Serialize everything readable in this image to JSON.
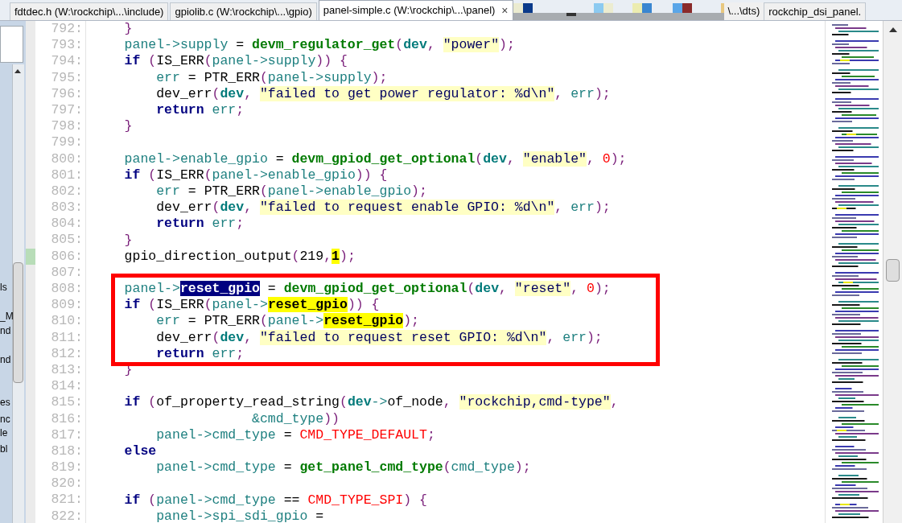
{
  "tabs": [
    {
      "label": "fdtdec.h (W:\\rockchip\\...\\include)",
      "selected": false
    },
    {
      "label": "gpiolib.c (W:\\rockchip\\...\\gpio)",
      "selected": false
    },
    {
      "label": "panel-simple.c (W:\\rockchip\\...\\panel)",
      "selected": true,
      "close": "×"
    },
    {
      "label": "\\...\\dts)",
      "selected": false,
      "kind": "covered"
    },
    {
      "label": "rockchip_dsi_panel.",
      "selected": false
    }
  ],
  "side_panel": {
    "fragments": [
      "ls",
      "_M",
      "nd",
      "nd",
      "es",
      "nc",
      "le",
      "bl"
    ]
  },
  "editor": {
    "lines": [
      {
        "number": "792:",
        "tokens": [
          {
            "text": "    }",
            "kind": "punct"
          }
        ]
      },
      {
        "number": "793:",
        "tokens": [
          {
            "text": "    panel->supply",
            "kind": "ident"
          },
          {
            "text": " = ",
            "kind": "plain"
          },
          {
            "text": "devm_regulator_get",
            "kind": "func"
          },
          {
            "text": "(",
            "kind": "punct"
          },
          {
            "text": "dev",
            "kind": "param"
          },
          {
            "text": ", ",
            "kind": "punct"
          },
          {
            "text": "\"power\"",
            "kind": "string"
          },
          {
            "text": ");",
            "kind": "punct"
          }
        ]
      },
      {
        "number": "794:",
        "tokens": [
          {
            "text": "    if",
            "kind": "keyword"
          },
          {
            "text": " (",
            "kind": "punct"
          },
          {
            "text": "IS_ERR",
            "kind": "plain"
          },
          {
            "text": "(",
            "kind": "punct"
          },
          {
            "text": "panel->supply",
            "kind": "ident"
          },
          {
            "text": ")) {",
            "kind": "punct"
          }
        ]
      },
      {
        "number": "795:",
        "tokens": [
          {
            "text": "        err",
            "kind": "ident"
          },
          {
            "text": " = ",
            "kind": "plain"
          },
          {
            "text": "PTR_ERR",
            "kind": "plain"
          },
          {
            "text": "(",
            "kind": "punct"
          },
          {
            "text": "panel->supply",
            "kind": "ident"
          },
          {
            "text": ");",
            "kind": "punct"
          }
        ]
      },
      {
        "number": "796:",
        "tokens": [
          {
            "text": "        dev_err",
            "kind": "plain"
          },
          {
            "text": "(",
            "kind": "punct"
          },
          {
            "text": "dev",
            "kind": "param"
          },
          {
            "text": ", ",
            "kind": "punct"
          },
          {
            "text": "\"failed to get power regulator: %d\\n\"",
            "kind": "string"
          },
          {
            "text": ", ",
            "kind": "punct"
          },
          {
            "text": "err",
            "kind": "ident"
          },
          {
            "text": ");",
            "kind": "punct"
          }
        ]
      },
      {
        "number": "797:",
        "tokens": [
          {
            "text": "        return",
            "kind": "keyword"
          },
          {
            "text": " err",
            "kind": "ident"
          },
          {
            "text": ";",
            "kind": "punct"
          }
        ]
      },
      {
        "number": "798:",
        "tokens": [
          {
            "text": "    }",
            "kind": "punct"
          }
        ]
      },
      {
        "number": "799:"
      },
      {
        "number": "800:",
        "tokens": [
          {
            "text": "    panel->enable_gpio",
            "kind": "ident"
          },
          {
            "text": " = ",
            "kind": "plain"
          },
          {
            "text": "devm_gpiod_get_optional",
            "kind": "func"
          },
          {
            "text": "(",
            "kind": "punct"
          },
          {
            "text": "dev",
            "kind": "param"
          },
          {
            "text": ", ",
            "kind": "punct"
          },
          {
            "text": "\"enable\"",
            "kind": "string"
          },
          {
            "text": ", ",
            "kind": "punct"
          },
          {
            "text": "0",
            "kind": "number"
          },
          {
            "text": ");",
            "kind": "punct"
          }
        ]
      },
      {
        "number": "801:",
        "tokens": [
          {
            "text": "    if",
            "kind": "keyword"
          },
          {
            "text": " (",
            "kind": "punct"
          },
          {
            "text": "IS_ERR",
            "kind": "plain"
          },
          {
            "text": "(",
            "kind": "punct"
          },
          {
            "text": "panel->enable_gpio",
            "kind": "ident"
          },
          {
            "text": ")) {",
            "kind": "punct"
          }
        ]
      },
      {
        "number": "802:",
        "tokens": [
          {
            "text": "        err",
            "kind": "ident"
          },
          {
            "text": " = ",
            "kind": "plain"
          },
          {
            "text": "PTR_ERR",
            "kind": "plain"
          },
          {
            "text": "(",
            "kind": "punct"
          },
          {
            "text": "panel->enable_gpio",
            "kind": "ident"
          },
          {
            "text": ");",
            "kind": "punct"
          }
        ]
      },
      {
        "number": "803:",
        "tokens": [
          {
            "text": "        dev_err",
            "kind": "plain"
          },
          {
            "text": "(",
            "kind": "punct"
          },
          {
            "text": "dev",
            "kind": "param"
          },
          {
            "text": ", ",
            "kind": "punct"
          },
          {
            "text": "\"failed to request enable GPIO: %d\\n\"",
            "kind": "string"
          },
          {
            "text": ", ",
            "kind": "punct"
          },
          {
            "text": "err",
            "kind": "ident"
          },
          {
            "text": ");",
            "kind": "punct"
          }
        ]
      },
      {
        "number": "804:",
        "tokens": [
          {
            "text": "        return",
            "kind": "keyword"
          },
          {
            "text": " err",
            "kind": "ident"
          },
          {
            "text": ";",
            "kind": "punct"
          }
        ]
      },
      {
        "number": "805:",
        "tokens": [
          {
            "text": "    }",
            "kind": "punct"
          }
        ]
      },
      {
        "number": "806:",
        "changed": true,
        "tokens": [
          {
            "text": "    gpio_direction_output",
            "kind": "plain"
          },
          {
            "text": "(",
            "kind": "punct"
          },
          {
            "text": "219",
            "kind": "plain"
          },
          {
            "text": ",",
            "kind": "punct"
          },
          {
            "text": "1",
            "kind": "highlight"
          },
          {
            "text": ");",
            "kind": "punct"
          }
        ]
      },
      {
        "number": "807:"
      },
      {
        "number": "808:",
        "boxed": true,
        "tokens": [
          {
            "text": "    panel->",
            "kind": "ident"
          },
          {
            "text": "reset_gpio",
            "kind": "selection"
          },
          {
            "text": " = ",
            "kind": "plain"
          },
          {
            "text": "devm_gpiod_get_optional",
            "kind": "func"
          },
          {
            "text": "(",
            "kind": "punct"
          },
          {
            "text": "dev",
            "kind": "param"
          },
          {
            "text": ", ",
            "kind": "punct"
          },
          {
            "text": "\"reset\"",
            "kind": "string"
          },
          {
            "text": ", ",
            "kind": "punct"
          },
          {
            "text": "0",
            "kind": "number"
          },
          {
            "text": ");",
            "kind": "punct"
          }
        ]
      },
      {
        "number": "809:",
        "boxed": true,
        "tokens": [
          {
            "text": "    if",
            "kind": "keyword"
          },
          {
            "text": " (",
            "kind": "punct"
          },
          {
            "text": "IS_ERR",
            "kind": "plain"
          },
          {
            "text": "(",
            "kind": "punct"
          },
          {
            "text": "panel->",
            "kind": "ident"
          },
          {
            "text": "reset_gpio",
            "kind": "highlight"
          },
          {
            "text": ")) {",
            "kind": "punct"
          }
        ]
      },
      {
        "number": "810:",
        "boxed": true,
        "tokens": [
          {
            "text": "        err",
            "kind": "ident"
          },
          {
            "text": " = ",
            "kind": "plain"
          },
          {
            "text": "PTR_ERR",
            "kind": "plain"
          },
          {
            "text": "(",
            "kind": "punct"
          },
          {
            "text": "panel->",
            "kind": "ident"
          },
          {
            "text": "reset_gpio",
            "kind": "highlight"
          },
          {
            "text": ");",
            "kind": "punct"
          }
        ]
      },
      {
        "number": "811:",
        "boxed": true,
        "tokens": [
          {
            "text": "        dev_err",
            "kind": "plain"
          },
          {
            "text": "(",
            "kind": "punct"
          },
          {
            "text": "dev",
            "kind": "param"
          },
          {
            "text": ", ",
            "kind": "punct"
          },
          {
            "text": "\"failed to request reset GPIO: %d\\n\"",
            "kind": "string"
          },
          {
            "text": ", ",
            "kind": "punct"
          },
          {
            "text": "err",
            "kind": "ident"
          },
          {
            "text": ");",
            "kind": "punct"
          }
        ]
      },
      {
        "number": "812:",
        "boxed": true,
        "tokens": [
          {
            "text": "        return",
            "kind": "keyword"
          },
          {
            "text": " err",
            "kind": "ident"
          },
          {
            "text": ";",
            "kind": "punct"
          }
        ]
      },
      {
        "number": "813:",
        "tokens": [
          {
            "text": "    }",
            "kind": "punct"
          }
        ]
      },
      {
        "number": "814:"
      },
      {
        "number": "815:",
        "tokens": [
          {
            "text": "    if",
            "kind": "keyword"
          },
          {
            "text": " (",
            "kind": "punct"
          },
          {
            "text": "of_property_read_string",
            "kind": "plain"
          },
          {
            "text": "(",
            "kind": "punct"
          },
          {
            "text": "dev",
            "kind": "param"
          },
          {
            "text": "->",
            "kind": "ident"
          },
          {
            "text": "of_node",
            "kind": "plain"
          },
          {
            "text": ", ",
            "kind": "punct"
          },
          {
            "text": "\"rockchip,cmd-type\"",
            "kind": "string"
          },
          {
            "text": ",",
            "kind": "punct"
          }
        ]
      },
      {
        "number": "816:",
        "tokens": [
          {
            "text": "                    &cmd_type",
            "kind": "ident"
          },
          {
            "text": "))",
            "kind": "punct"
          }
        ]
      },
      {
        "number": "817:",
        "tokens": [
          {
            "text": "        panel->cmd_type",
            "kind": "ident"
          },
          {
            "text": " = ",
            "kind": "plain"
          },
          {
            "text": "CMD_TYPE_DEFAULT",
            "kind": "macro"
          },
          {
            "text": ";",
            "kind": "punct"
          }
        ]
      },
      {
        "number": "818:",
        "tokens": [
          {
            "text": "    else",
            "kind": "keyword"
          }
        ]
      },
      {
        "number": "819:",
        "tokens": [
          {
            "text": "        panel->cmd_type",
            "kind": "ident"
          },
          {
            "text": " = ",
            "kind": "plain"
          },
          {
            "text": "get_panel_cmd_type",
            "kind": "func"
          },
          {
            "text": "(",
            "kind": "punct"
          },
          {
            "text": "cmd_type",
            "kind": "ident"
          },
          {
            "text": ");",
            "kind": "punct"
          }
        ]
      },
      {
        "number": "820:"
      },
      {
        "number": "821:",
        "tokens": [
          {
            "text": "    if",
            "kind": "keyword"
          },
          {
            "text": " (",
            "kind": "punct"
          },
          {
            "text": "panel->cmd_type",
            "kind": "ident"
          },
          {
            "text": " == ",
            "kind": "plain"
          },
          {
            "text": "CMD_TYPE_SPI",
            "kind": "macro"
          },
          {
            "text": ") {",
            "kind": "punct"
          }
        ]
      },
      {
        "number": "822:",
        "tokens": [
          {
            "text": "        panel->spi_sdi_gpio",
            "kind": "ident"
          },
          {
            "text": " =",
            "kind": "plain"
          }
        ]
      }
    ]
  }
}
